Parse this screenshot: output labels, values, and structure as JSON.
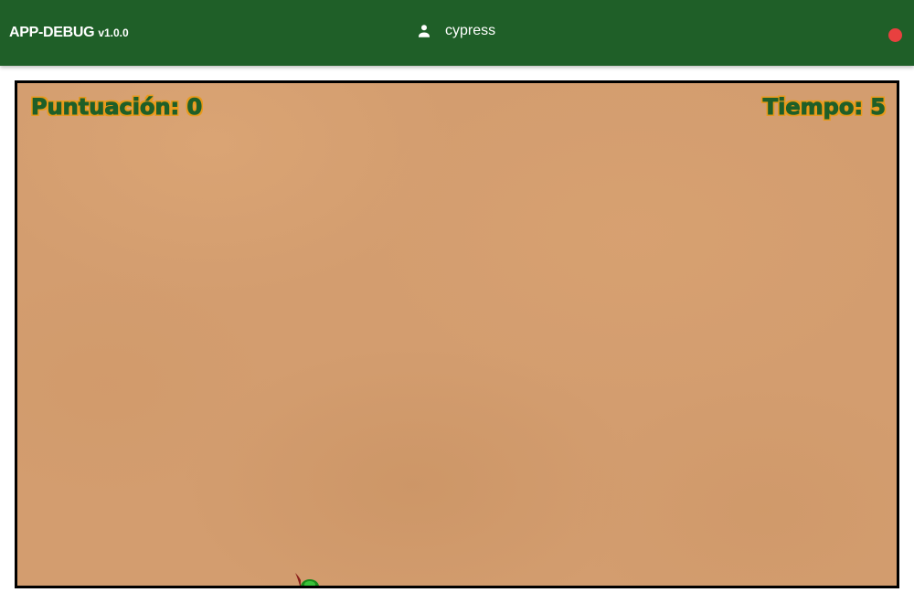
{
  "header": {
    "app_name": "APP-DEBUG",
    "version": "v1.0.0",
    "user_icon": "person-icon",
    "username": "cypress",
    "status_indicator_color": "#e8403f",
    "background_color": "#1f5f28"
  },
  "game": {
    "score_label": "Puntuación: 0",
    "time_label": "Tiempo: 5",
    "score_value": 0,
    "time_value": 5,
    "hud_text_color": "#1f5f28",
    "hud_outline_color": "#e89a1a",
    "background_color": "#d39d6f",
    "sprite": "mole-sprite"
  }
}
